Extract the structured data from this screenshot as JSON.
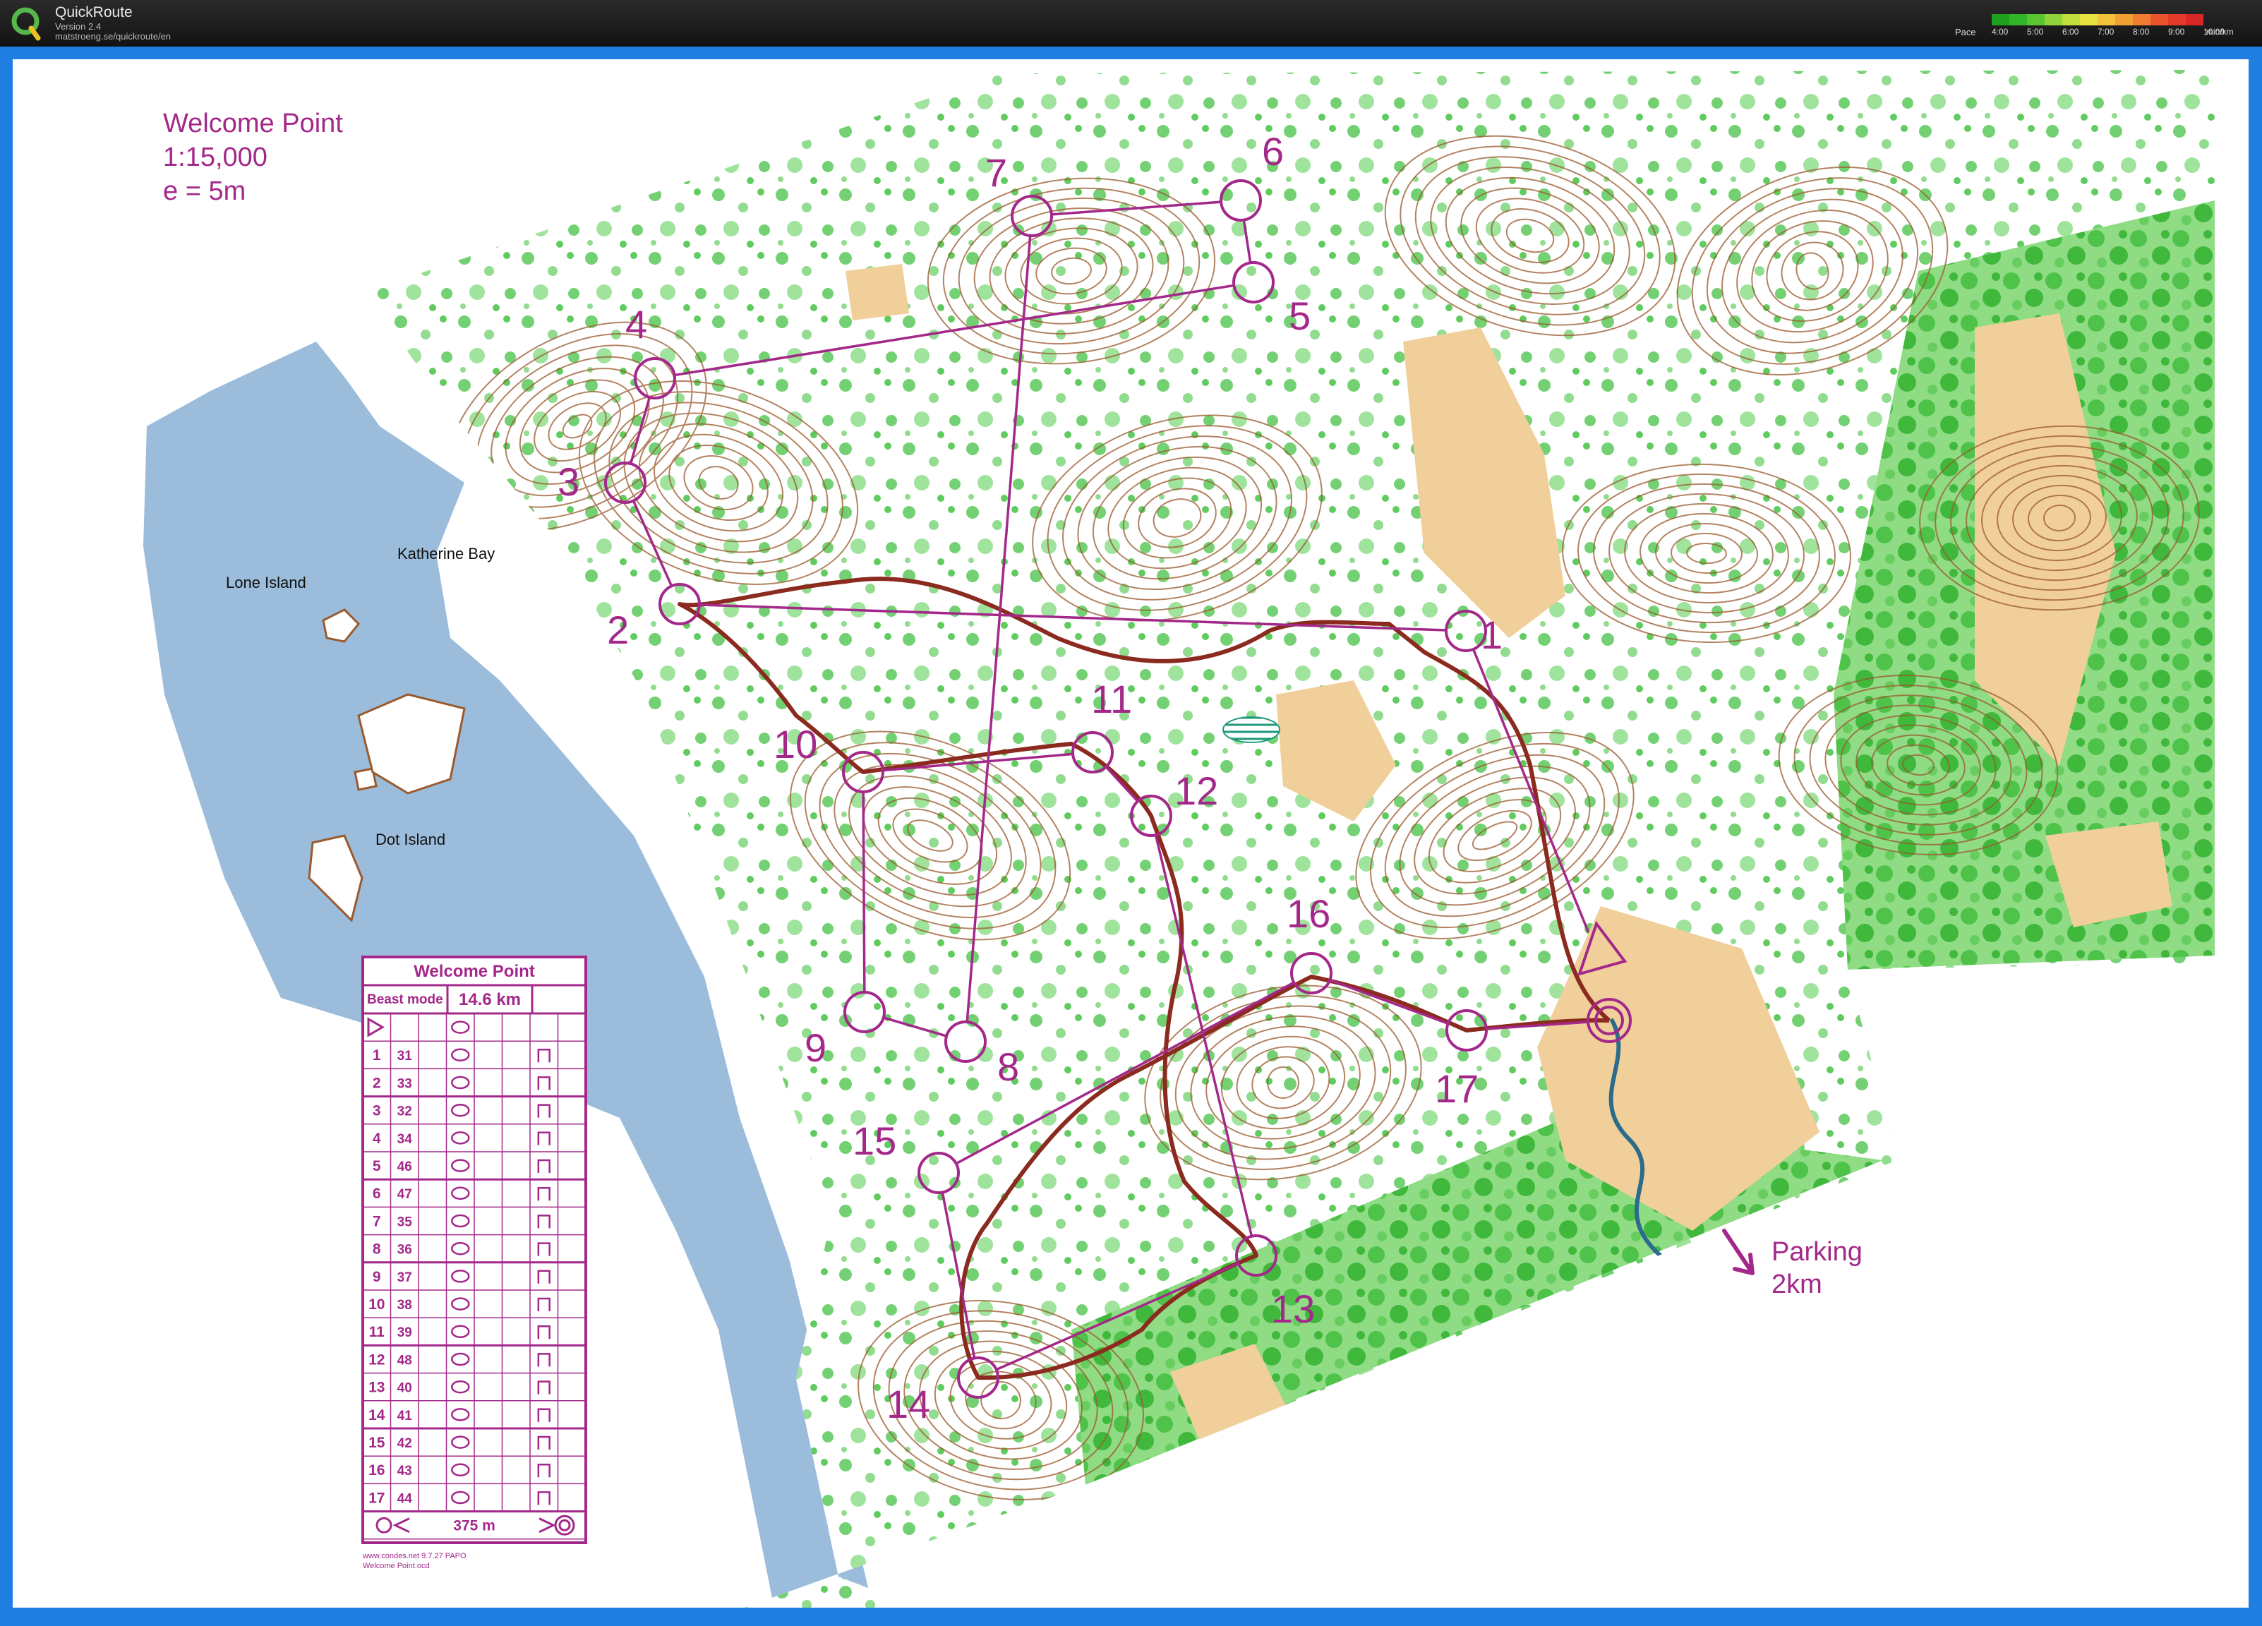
{
  "app": {
    "name": "QuickRoute",
    "version": "Version 2.4",
    "url": "matstroeng.se/quickroute/en"
  },
  "pace_legend": {
    "label": "Pace",
    "ticks": [
      "4:00",
      "5:00",
      "6:00",
      "7:00",
      "8:00",
      "9:00",
      "10:00"
    ],
    "unit": "min/km",
    "colors": [
      "#1fa31f",
      "#33b52a",
      "#59c531",
      "#8fd33a",
      "#c2de3d",
      "#e7e241",
      "#f2c33a",
      "#f2a034",
      "#ef7c30",
      "#e9552d",
      "#e33a2a",
      "#d92727"
    ]
  },
  "colors": {
    "course": "#a3288a",
    "route": "#8b2a1e",
    "water": "#9bbcdb",
    "vegetation": "#44c241",
    "open_land": "#f1cf9a",
    "contour": "#9a5a2e"
  },
  "map": {
    "title": "Welcome Point",
    "scale": "1:15,000",
    "contour_interval": "e = 5m",
    "place_names": [
      "Katherine Bay",
      "Lone Island",
      "Dot Island"
    ],
    "parking": {
      "label": "Parking",
      "distance": "2km"
    },
    "controls": [
      "1",
      "2",
      "3",
      "4",
      "5",
      "6",
      "7",
      "8",
      "9",
      "10",
      "11",
      "12",
      "13",
      "14",
      "15",
      "16",
      "17"
    ]
  },
  "control_card": {
    "event": "Welcome Point",
    "class": "Beast mode",
    "length": "14.6 km",
    "rows": [
      {
        "n": "1",
        "code": "31"
      },
      {
        "n": "2",
        "code": "33"
      },
      {
        "n": "3",
        "code": "32"
      },
      {
        "n": "4",
        "code": "34"
      },
      {
        "n": "5",
        "code": "46"
      },
      {
        "n": "6",
        "code": "47"
      },
      {
        "n": "7",
        "code": "35"
      },
      {
        "n": "8",
        "code": "36"
      },
      {
        "n": "9",
        "code": "37"
      },
      {
        "n": "10",
        "code": "38"
      },
      {
        "n": "11",
        "code": "39"
      },
      {
        "n": "12",
        "code": "48"
      },
      {
        "n": "13",
        "code": "40"
      },
      {
        "n": "14",
        "code": "41"
      },
      {
        "n": "15",
        "code": "42"
      },
      {
        "n": "16",
        "code": "43"
      },
      {
        "n": "17",
        "code": "44"
      }
    ],
    "finish_distance": "375 m",
    "footer_1": "www.condes.net 9.7.27 PAPO",
    "footer_2": "Welcome Point.ocd"
  }
}
